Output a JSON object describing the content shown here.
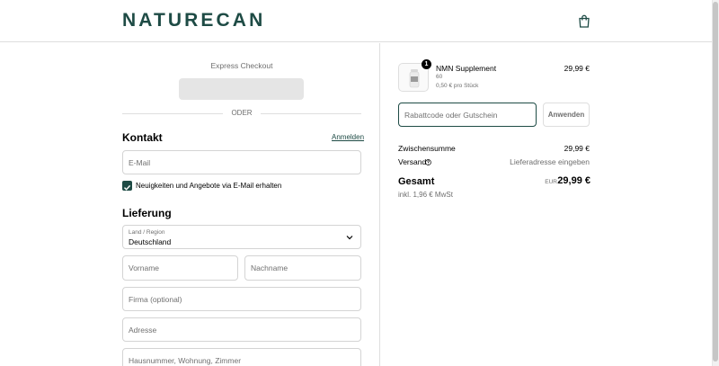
{
  "header": {
    "logo": "NATURECAN",
    "bag_icon": "shopping-bag-icon"
  },
  "checkout": {
    "express_label": "Express Checkout",
    "divider_label": "ODER",
    "contact": {
      "title": "Kontakt",
      "login_link": "Anmelden",
      "email_placeholder": "E-Mail",
      "newsletter_label": "Neuigkeiten und Angebote via E-Mail erhalten",
      "newsletter_checked": true
    },
    "delivery": {
      "title": "Lieferung",
      "country_label": "Land / Region",
      "country_value": "Deutschland",
      "first_name_placeholder": "Vorname",
      "last_name_placeholder": "Nachname",
      "company_placeholder": "Firma (optional)",
      "address_placeholder": "Adresse",
      "address2_placeholder": "Hausnummer, Wohnung, Zimmer"
    }
  },
  "summary": {
    "product": {
      "quantity": "1",
      "name": "NMN Supplement",
      "variant": "60",
      "unit_price": "0,50 € pro Stück",
      "price": "29,99 €"
    },
    "discount_placeholder": "Rabattcode oder Gutschein",
    "apply_label": "Anwenden",
    "subtotal_label": "Zwischensumme",
    "subtotal_value": "29,99 €",
    "shipping_label": "Versand",
    "shipping_value": "Lieferadresse eingeben",
    "total_label": "Gesamt",
    "total_currency": "EUR",
    "total_value": "29,99 €",
    "vat_note": "inkl. 1,96 € MwSt"
  },
  "colors": {
    "brand": "#1e4b45",
    "muted": "#6e6e6e",
    "border": "#d4d4d4"
  }
}
